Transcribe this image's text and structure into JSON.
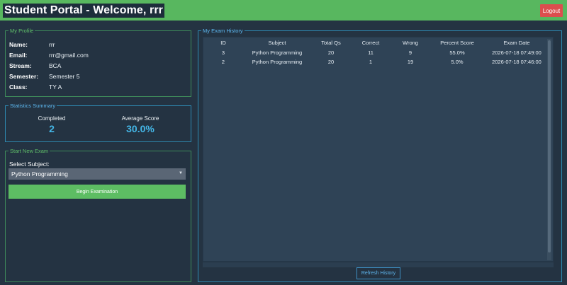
{
  "header": {
    "title": "Student Portal - Welcome, rrr",
    "logout_label": "Logout"
  },
  "profile": {
    "legend": "My Profile",
    "rows": [
      {
        "key": "Name:",
        "value": "rrr"
      },
      {
        "key": "Email:",
        "value": "rrr@gmail.com"
      },
      {
        "key": "Stream:",
        "value": "BCA"
      },
      {
        "key": "Semester:",
        "value": "Semester 5"
      },
      {
        "key": "Class:",
        "value": "TY A"
      }
    ]
  },
  "stats": {
    "legend": "Statistics Summary",
    "completed_label": "Completed",
    "completed_value": "2",
    "average_label": "Average Score",
    "average_value": "30.0%"
  },
  "new_exam": {
    "legend": "Start New Exam",
    "select_label": "Select Subject:",
    "selected_subject": "Python Programming",
    "begin_label": "Begin Examination"
  },
  "history": {
    "legend": "My Exam History",
    "columns": [
      "ID",
      "Subject",
      "Total Qs",
      "Correct",
      "Wrong",
      "Percent Score",
      "Exam Date"
    ],
    "rows": [
      [
        "3",
        "Python Programming",
        "20",
        "11",
        "9",
        "55.0%",
        "2026-07-18 07:49:00"
      ],
      [
        "2",
        "Python Programming",
        "20",
        "1",
        "19",
        "5.0%",
        "2026-07-18 07:46:00"
      ]
    ],
    "refresh_label": "Refresh History"
  },
  "colors": {
    "header_green": "#58b75f",
    "logout_red": "#dc4e4e",
    "background": "#243342",
    "accent_blue": "#44b6e6",
    "button_green": "#5dbd63"
  }
}
